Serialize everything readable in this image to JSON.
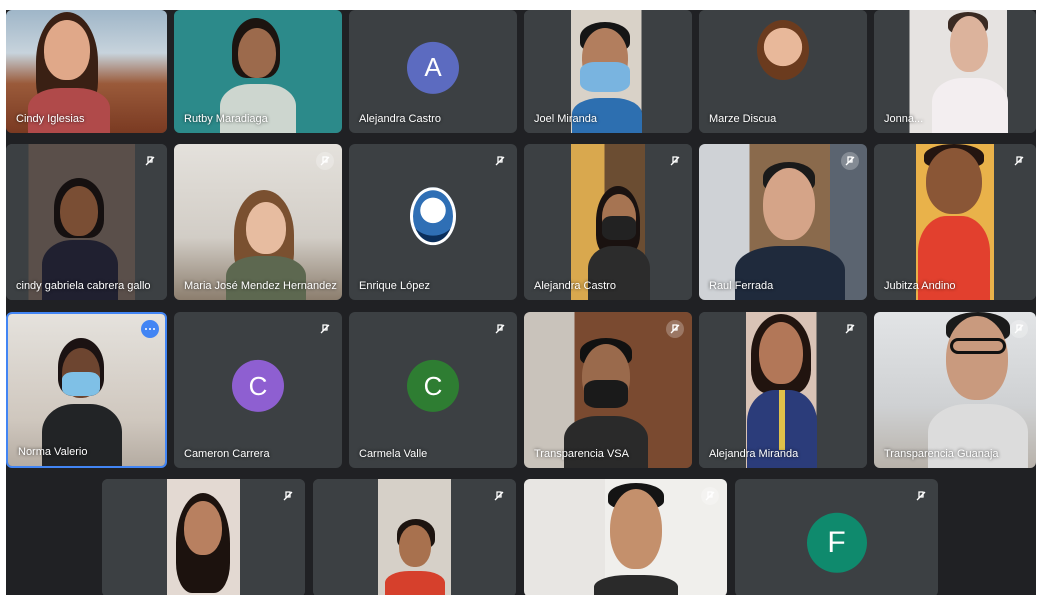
{
  "participants": [
    {
      "name": "Cindy Iglesias",
      "muted": false
    },
    {
      "name": "Rutby Maradiaga",
      "muted": false
    },
    {
      "name": "Alejandra Castro",
      "muted": false,
      "initial": "A",
      "color": "#5c6bc0"
    },
    {
      "name": "Joel Miranda",
      "muted": false
    },
    {
      "name": "Marze Discua",
      "muted": false
    },
    {
      "name": "Jonna...",
      "muted": false
    },
    {
      "name": "cindy gabriela cabrera gallo",
      "muted": true
    },
    {
      "name": "Maria José Mendez Hernandez",
      "muted": true
    },
    {
      "name": "Enrique López",
      "muted": true
    },
    {
      "name": "Alejandra Castro",
      "muted": true
    },
    {
      "name": "Raul Ferrada",
      "muted": true
    },
    {
      "name": "Jubitza Andino",
      "muted": true
    },
    {
      "name": "Norma Valerio",
      "muted": false
    },
    {
      "name": "Cameron Carrera",
      "muted": true,
      "initial": "C",
      "color": "#8e5fd1"
    },
    {
      "name": "Carmela Valle",
      "muted": true,
      "initial": "C",
      "color": "#2e7d32"
    },
    {
      "name": "Transparencia VSA",
      "muted": true
    },
    {
      "name": "Alejandra Miranda",
      "muted": true
    },
    {
      "name": "Transparencia Guanaja",
      "muted": true
    },
    {
      "name": "",
      "muted": true
    },
    {
      "name": "",
      "muted": true
    },
    {
      "name": "",
      "muted": true
    },
    {
      "name": "",
      "muted": true,
      "initial": "F",
      "color": "#0f8a6d"
    }
  ],
  "colors": {
    "stage": "#202124",
    "tile": "#3c4043",
    "active_border": "#4285f4"
  },
  "icons": {
    "mute": "mic-off-icon",
    "options": "more-options-icon"
  }
}
